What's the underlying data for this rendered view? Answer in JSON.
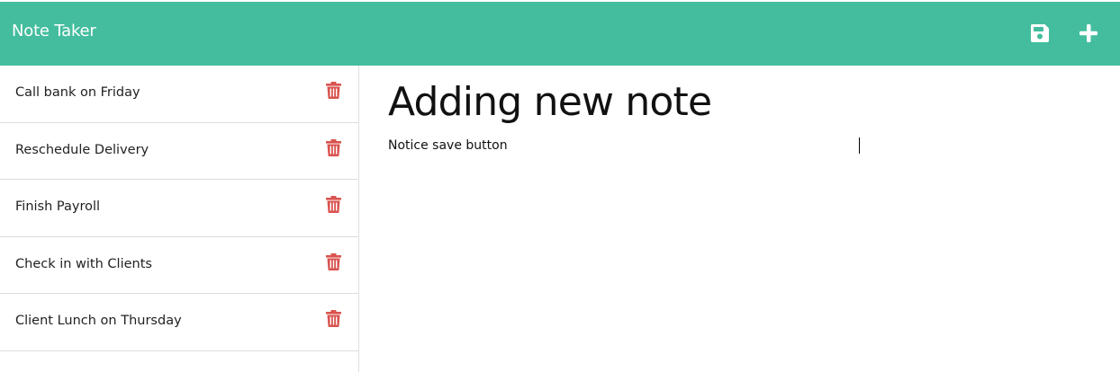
{
  "app": {
    "title": "Note Taker",
    "accent_color": "#43bd9e"
  },
  "toolbar": {
    "save_icon": "floppy-disk-icon",
    "new_icon": "plus-icon"
  },
  "notes": [
    {
      "title": "Call bank on Friday"
    },
    {
      "title": "Reschedule Delivery"
    },
    {
      "title": "Finish Payroll"
    },
    {
      "title": "Check in with Clients"
    },
    {
      "title": "Client Lunch on Thursday"
    }
  ],
  "delete_icon": {
    "name": "trash-icon",
    "color": "#d9534f"
  },
  "editor": {
    "title_value": "Adding new note",
    "body_value": "Notice save button"
  }
}
